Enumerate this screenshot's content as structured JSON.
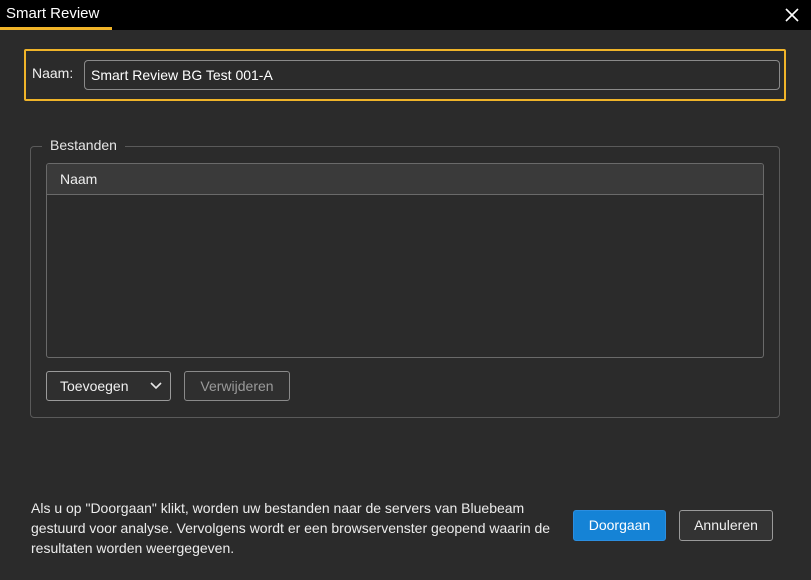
{
  "window": {
    "title": "Smart Review"
  },
  "name_row": {
    "label": "Naam:",
    "value": "Smart Review BG Test 001-A"
  },
  "files": {
    "group_label": "Bestanden",
    "columns": [
      "Naam"
    ],
    "rows": [],
    "add_button": "Toevoegen",
    "remove_button": "Verwijderen"
  },
  "footer": {
    "info": "Als u op \"Doorgaan\" klikt, worden uw bestanden naar de servers van Bluebeam gestuurd voor analyse. Vervolgens wordt er een browservenster geopend waarin de resultaten worden weergegeven.",
    "continue_button": "Doorgaan",
    "cancel_button": "Annuleren"
  },
  "colors": {
    "accent": "#f0b429",
    "primary_button": "#1583d6",
    "background": "#2b2b2b"
  },
  "icons": {
    "close": "close-icon",
    "dropdown": "chevron-down-icon"
  }
}
